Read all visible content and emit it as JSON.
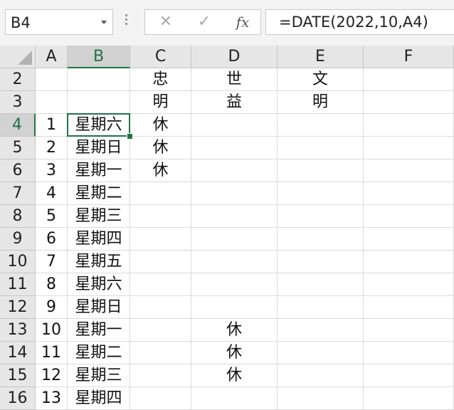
{
  "name_box": "B4",
  "formula": "=DATE(2022,10,A4)",
  "fx_cancel": "✕",
  "fx_enter": "✓",
  "fx_label": "fx",
  "selected_cell": "B4",
  "columns": [
    "A",
    "B",
    "C",
    "D",
    "E",
    "F"
  ],
  "rows": [
    {
      "header": "2",
      "cells": [
        "",
        "",
        "忠",
        "世",
        "文",
        ""
      ]
    },
    {
      "header": "3",
      "cells": [
        "",
        "",
        "明",
        "益",
        "明",
        ""
      ]
    },
    {
      "header": "4",
      "cells": [
        "1",
        "星期六",
        "休",
        "",
        "",
        ""
      ]
    },
    {
      "header": "5",
      "cells": [
        "2",
        "星期日",
        "休",
        "",
        "",
        ""
      ]
    },
    {
      "header": "6",
      "cells": [
        "3",
        "星期一",
        "休",
        "",
        "",
        ""
      ]
    },
    {
      "header": "7",
      "cells": [
        "4",
        "星期二",
        "",
        "",
        "",
        ""
      ]
    },
    {
      "header": "8",
      "cells": [
        "5",
        "星期三",
        "",
        "",
        "",
        ""
      ]
    },
    {
      "header": "9",
      "cells": [
        "6",
        "星期四",
        "",
        "",
        "",
        ""
      ]
    },
    {
      "header": "10",
      "cells": [
        "7",
        "星期五",
        "",
        "",
        "",
        ""
      ]
    },
    {
      "header": "11",
      "cells": [
        "8",
        "星期六",
        "",
        "",
        "",
        ""
      ]
    },
    {
      "header": "12",
      "cells": [
        "9",
        "星期日",
        "",
        "",
        "",
        ""
      ]
    },
    {
      "header": "13",
      "cells": [
        "10",
        "星期一",
        "",
        "休",
        "",
        ""
      ]
    },
    {
      "header": "14",
      "cells": [
        "11",
        "星期二",
        "",
        "休",
        "",
        ""
      ]
    },
    {
      "header": "15",
      "cells": [
        "12",
        "星期三",
        "",
        "休",
        "",
        ""
      ]
    },
    {
      "header": "16",
      "cells": [
        "13",
        "星期四",
        "",
        "",
        "",
        ""
      ]
    }
  ],
  "colors": {
    "accent": "#217346",
    "header_bg": "#e6e6e6",
    "gridline": "#dadada"
  }
}
